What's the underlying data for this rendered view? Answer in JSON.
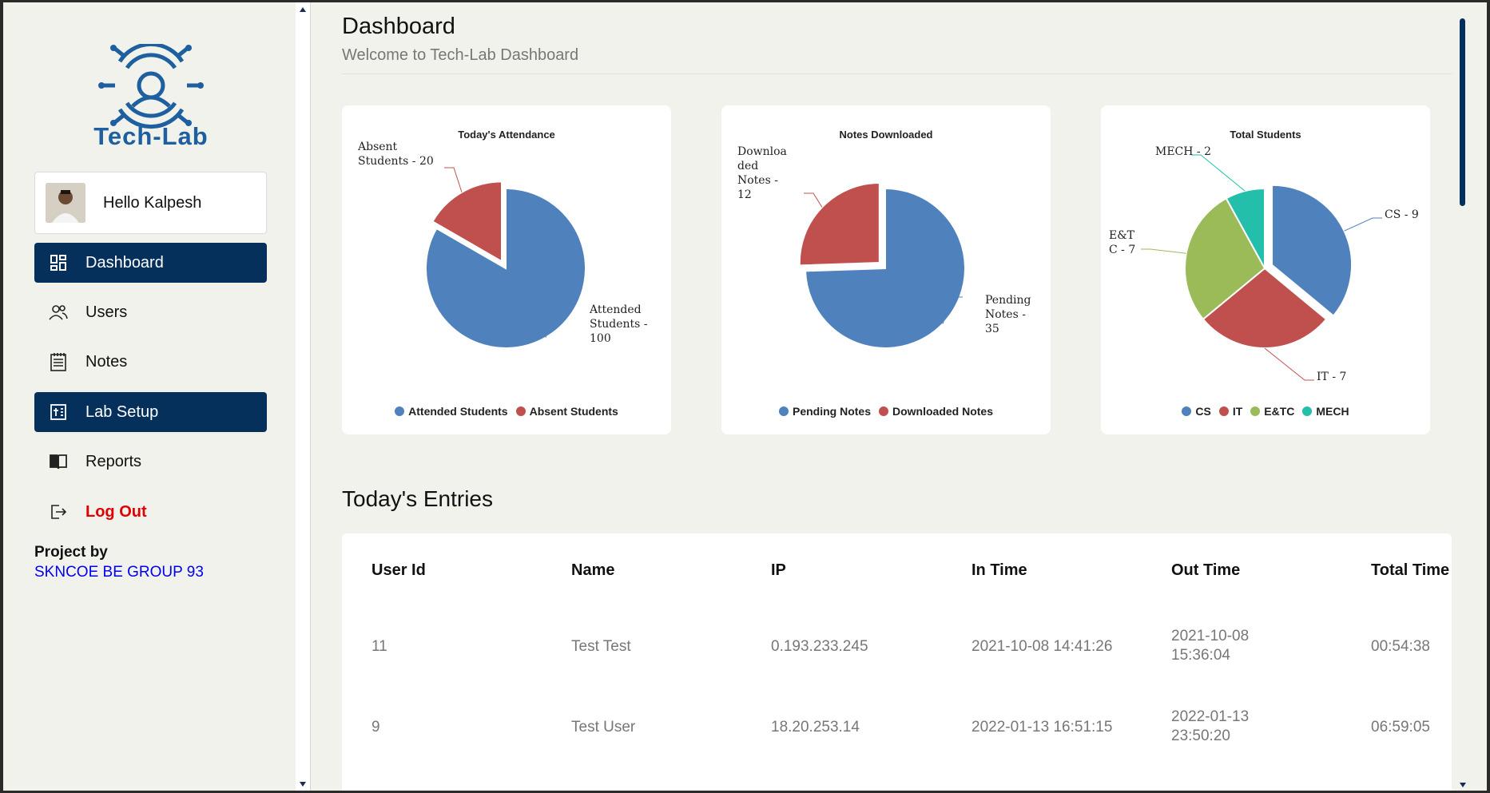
{
  "sidebar": {
    "logo_text": "Tech-Lab",
    "user_greeting": "Hello Kalpesh",
    "items": [
      {
        "label": "Dashboard",
        "icon": "dashboard-icon",
        "active": true
      },
      {
        "label": "Users",
        "icon": "users-icon",
        "active": false
      },
      {
        "label": "Notes",
        "icon": "notes-icon",
        "active": false
      },
      {
        "label": "Lab Setup",
        "icon": "lab-setup-icon",
        "active": true
      },
      {
        "label": "Reports",
        "icon": "book-icon",
        "active": false
      },
      {
        "label": "Log Out",
        "icon": "logout-icon",
        "active": false
      }
    ],
    "project_by": "Project by",
    "project_name": "SKNCOE BE GROUP 93"
  },
  "main": {
    "title": "Dashboard",
    "subtitle": "Welcome to Tech-Lab Dashboard",
    "entries_title": "Today's Entries",
    "table": {
      "headers": [
        "User Id",
        "Name",
        "IP",
        "In Time",
        "Out Time",
        "Total Time"
      ],
      "rows": [
        {
          "user_id": "11",
          "name": "Test Test",
          "ip": "0.193.233.245",
          "in_time": "2021-10-08 14:41:26",
          "out_date": "2021-10-08",
          "out_clock": "15:36:04",
          "total": "00:54:38"
        },
        {
          "user_id": "9",
          "name": "Test User",
          "ip": "18.20.253.14",
          "in_time": "2022-01-13 16:51:15",
          "out_date": "2022-01-13",
          "out_clock": "23:50:20",
          "total": "06:59:05"
        }
      ]
    }
  },
  "colors": {
    "blue": "#4f81bd",
    "red": "#c0504d",
    "green": "#9bbb59",
    "teal": "#23bfaa",
    "nav_active": "#06305c"
  },
  "chart_data": [
    {
      "type": "pie",
      "title": "Today's Attendance",
      "labels": [
        "Attended Students",
        "Absent Students"
      ],
      "values": [
        100,
        20
      ],
      "data_labels": [
        [
          "Attended",
          "Students -",
          "100"
        ],
        [
          "Absent",
          "Students - 20"
        ]
      ],
      "legend_placement": "bottom"
    },
    {
      "type": "pie",
      "title": "Notes Downloaded",
      "labels": [
        "Pending Notes",
        "Downloaded Notes"
      ],
      "values": [
        35,
        12
      ],
      "data_labels": [
        [
          "Pending",
          "Notes -",
          "35"
        ],
        [
          "Downloa",
          "ded",
          "Notes -",
          "12"
        ]
      ],
      "legend_placement": "bottom"
    },
    {
      "type": "pie",
      "title": "Total Students",
      "labels": [
        "CS",
        "IT",
        "E&TC",
        "MECH"
      ],
      "values": [
        9,
        7,
        7,
        2
      ],
      "data_labels": [
        [
          "CS - 9"
        ],
        [
          "IT - 7"
        ],
        [
          "E&T",
          "C - 7"
        ],
        [
          "MECH - 2"
        ]
      ],
      "legend_placement": "bottom"
    }
  ]
}
